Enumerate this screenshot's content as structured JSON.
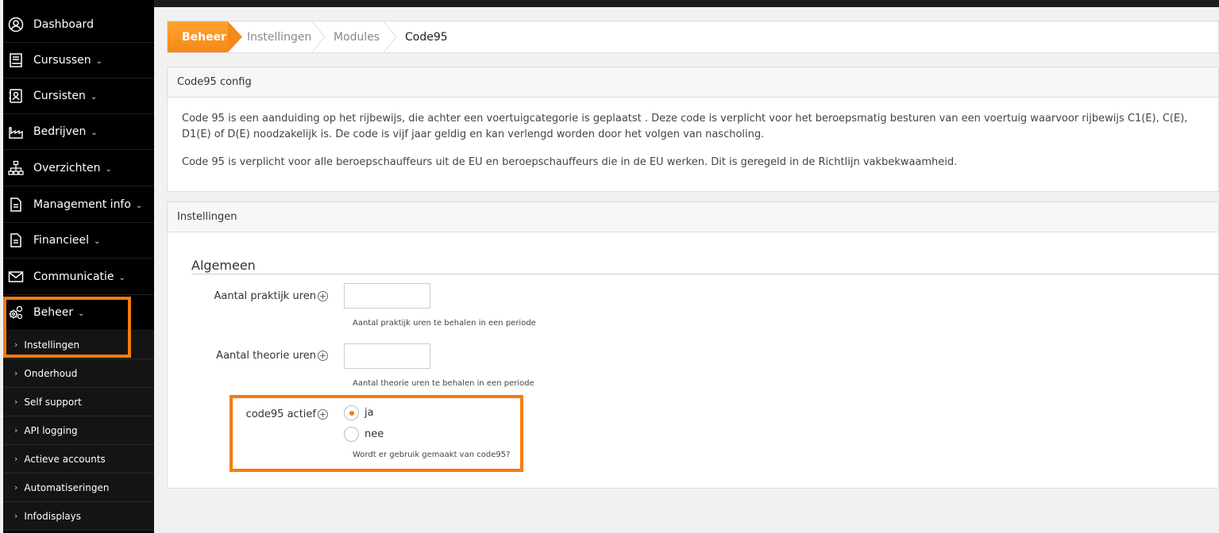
{
  "sidebar": {
    "items": [
      {
        "label": "Dashboard",
        "icon": "user-circle-icon",
        "has_chevron": false
      },
      {
        "label": "Cursussen",
        "icon": "book-icon",
        "has_chevron": true
      },
      {
        "label": "Cursisten",
        "icon": "id-badge-icon",
        "has_chevron": true
      },
      {
        "label": "Bedrijven",
        "icon": "industry-icon",
        "has_chevron": true
      },
      {
        "label": "Overzichten",
        "icon": "sitemap-icon",
        "has_chevron": true
      },
      {
        "label": "Management info",
        "icon": "document-icon",
        "has_chevron": true
      },
      {
        "label": "Financieel",
        "icon": "document-icon",
        "has_chevron": true
      },
      {
        "label": "Communicatie",
        "icon": "envelope-icon",
        "has_chevron": true
      },
      {
        "label": "Beheer",
        "icon": "gears-icon",
        "has_chevron": true
      }
    ],
    "chevron": "⌄",
    "sub_items": [
      {
        "label": "Instellingen"
      },
      {
        "label": "Onderhoud"
      },
      {
        "label": "Self support"
      },
      {
        "label": "API logging"
      },
      {
        "label": "Actieve accounts"
      },
      {
        "label": "Automatiseringen"
      },
      {
        "label": "Infodisplays"
      }
    ],
    "sub_arrow": "›"
  },
  "breadcrumb": {
    "items": [
      "Beheer",
      "Instellingen",
      "Modules",
      "Code95"
    ]
  },
  "config_panel": {
    "title": "Code95 config",
    "paragraphs": [
      "Code 95 is een aanduiding op het rijbewijs, die achter een voertuigcategorie is geplaatst . Deze code is verplicht voor het beroepsmatig besturen van een voertuig waarvoor rijbewijs C1(E), C(E), D1(E) of D(E) noodzakelijk is. De code is vijf jaar geldig en kan verlengd worden door het volgen van nascholing.",
      "Code 95 is verplicht voor alle beroepschauffeurs uit de EU en beroepschauffeurs die in de EU werken. Dit is geregeld in de Richtlijn vakbekwaamheid."
    ]
  },
  "settings_panel": {
    "title": "Instellingen",
    "section": "Algemeen",
    "plus_glyph": "+",
    "fields": {
      "praktijk": {
        "label": "Aantal praktijk uren",
        "value": "",
        "help": "Aantal praktijk uren te behalen in een periode"
      },
      "theorie": {
        "label": "Aantal theorie uren",
        "value": "",
        "help": "Aantal theorie uren te behalen in een periode"
      },
      "actief": {
        "label": "code95 actief",
        "options": [
          "ja",
          "nee"
        ],
        "selected": "ja",
        "help": "Wordt er gebruik gemaakt van code95?"
      }
    }
  },
  "colors": {
    "accent": "#f77b0d",
    "sidebar_bg": "#000000",
    "highlight_border": "#f77b0d"
  }
}
